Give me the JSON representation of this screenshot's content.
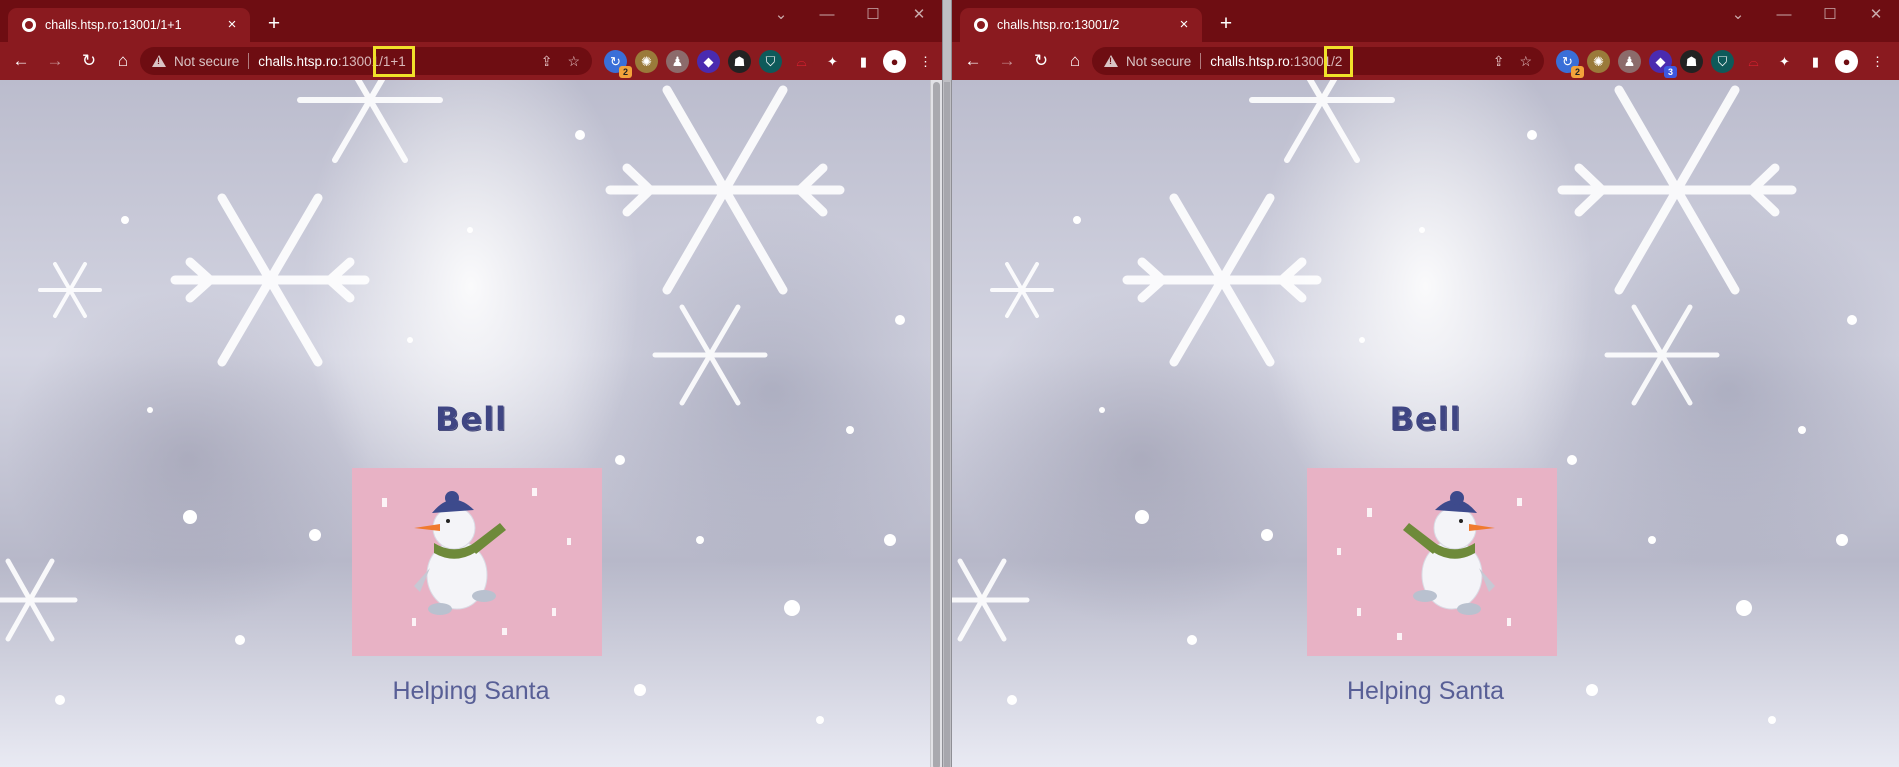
{
  "browsers": [
    {
      "tab_title": "challs.htsp.ro:13001/1+1",
      "omnibox": {
        "security_label": "Not secure",
        "host": "challs.htsp.ro",
        "port": ":13001",
        "path": "/1+1"
      },
      "extension_badges": [
        "2"
      ],
      "page": {
        "heading": "Bell",
        "caption": "Helping Santa"
      }
    },
    {
      "tab_title": "challs.htsp.ro:13001/2",
      "omnibox": {
        "security_label": "Not secure",
        "host": "challs.htsp.ro",
        "port": ":13001",
        "path": "/2"
      },
      "extension_badges": [
        "2",
        "3"
      ],
      "page": {
        "heading": "Bell",
        "caption": "Helping Santa"
      }
    }
  ],
  "icons": {
    "tab_close": "×",
    "new_tab": "+",
    "minimize": "—",
    "maximize": "☐",
    "close": "✕",
    "back": "←",
    "forward": "→",
    "reload": "↻",
    "home": "⌂",
    "share": "⇪",
    "bookmark": "☆",
    "extensions": "✦",
    "side_panel": "▮",
    "profile": "●",
    "menu": "⋮"
  },
  "colors": {
    "titlebar": "#6e0d12",
    "toolbar": "#8a1a1f",
    "highlight_box": "#f0e12a",
    "heading": "#3f4583",
    "caption": "#585f96",
    "picture_bg": "#e8b2c5"
  }
}
